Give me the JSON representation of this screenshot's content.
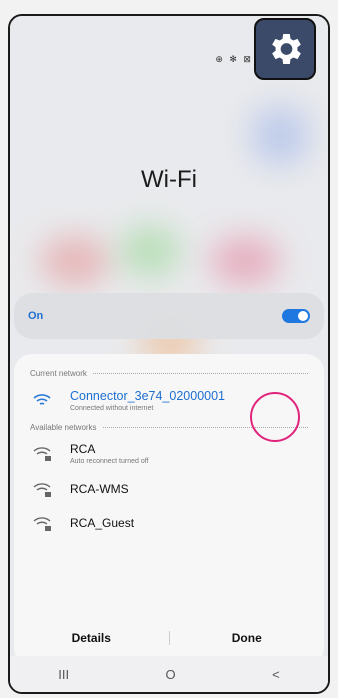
{
  "status_bar": {
    "icons_text": "⊕ ✻ ⊠ ◂"
  },
  "header": {
    "title": "Wi-Fi"
  },
  "toggle_row": {
    "label": "On",
    "enabled": true
  },
  "current": {
    "section_label": "Current network",
    "network": {
      "name": "Connector_3e74_02000001",
      "status": "Connected without internet"
    }
  },
  "available": {
    "section_label": "Available networks",
    "networks": [
      {
        "name": "RCA",
        "status": "Auto reconnect turned off"
      },
      {
        "name": "RCA-WMS",
        "status": ""
      },
      {
        "name": "RCA_Guest",
        "status": ""
      }
    ]
  },
  "actions": {
    "details_label": "Details",
    "done_label": "Done"
  },
  "nav": {
    "recent": "III",
    "home": "O",
    "back": "<"
  },
  "colors": {
    "accent": "#1e78e0",
    "highlight": "#e0247c",
    "gear_bg": "#3a4a68"
  }
}
